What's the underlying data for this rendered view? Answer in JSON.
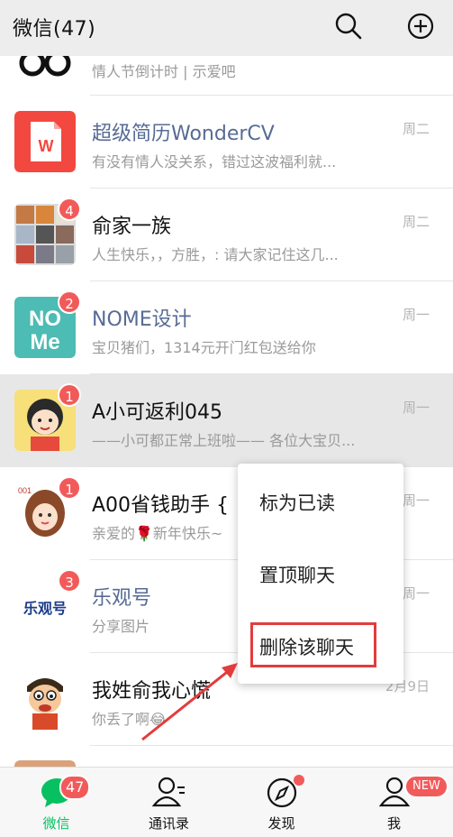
{
  "header": {
    "title": "微信(47)"
  },
  "chats": [
    {
      "name": "",
      "preview": "情人节倒计时 | 示爱吧",
      "time": ""
    },
    {
      "name": "超级简历WonderCV",
      "preview": "有没有情人没关系，错过这波福利就...",
      "time": "周二",
      "badge": ""
    },
    {
      "name": "俞家一族",
      "preview": "人生快乐，，方胜，: 请大家记住这几...",
      "time": "周二",
      "badge": "4"
    },
    {
      "name": "NOME设计",
      "preview": "宝贝猪们，1314元开门红包送给你",
      "time": "周一",
      "badge": "2"
    },
    {
      "name": "A小可返利045",
      "preview": "——小可都正常上班啦—— 各位大宝贝...",
      "time": "周一",
      "badge": "1"
    },
    {
      "name": "A00省钱助手 {",
      "preview": "亲爱的🌹新年快乐~",
      "time": "周一",
      "badge": "1"
    },
    {
      "name": "乐观号",
      "preview": "分享图片",
      "time": "周一",
      "badge": "3"
    },
    {
      "name": "我姓俞我心慌",
      "preview": "你丢了啊😂",
      "time": "2月9日",
      "badge": ""
    }
  ],
  "context_menu": {
    "items": [
      "标为已读",
      "置顶聊天",
      "删除该聊天"
    ]
  },
  "avatars": {
    "nome_text_top": "NO",
    "nome_text_bottom": "Me",
    "leguan_text": "乐观号",
    "a00_tag": "001"
  },
  "tabbar": {
    "tabs": [
      {
        "label": "微信",
        "badge": "47"
      },
      {
        "label": "通讯录"
      },
      {
        "label": "发现"
      },
      {
        "label": "我",
        "badge": "NEW"
      }
    ]
  },
  "colors": {
    "accent_green": "#07c160",
    "badge_red": "#f25a5a",
    "official_blue": "#576b95",
    "highlight_red": "#e23c3c"
  }
}
